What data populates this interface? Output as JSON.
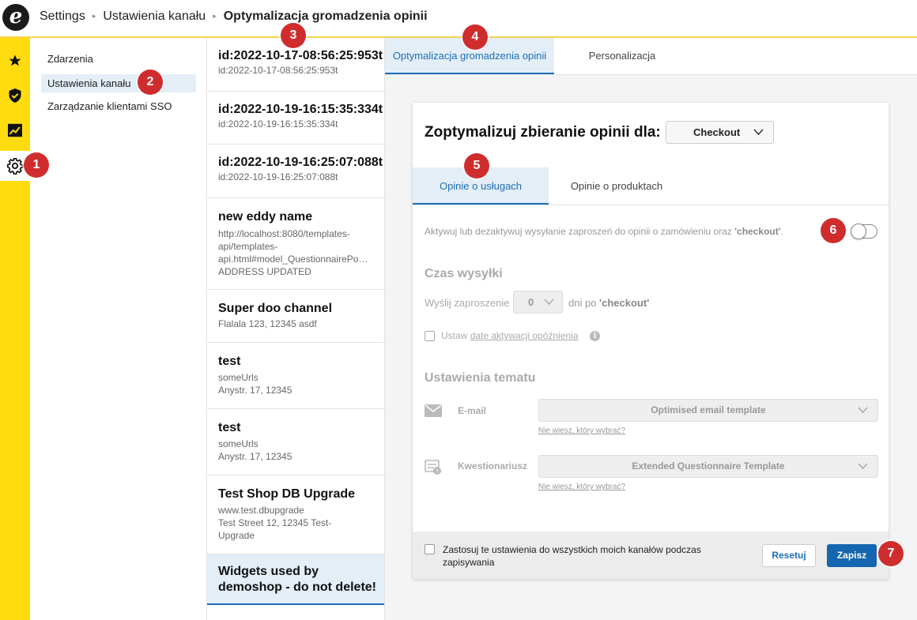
{
  "header": {
    "logo_letter": "e",
    "breadcrumbs": [
      "Settings",
      "Ustawienia kanału",
      "Optymalizacja gromadzenia opinii"
    ]
  },
  "rail": {
    "items": [
      {
        "icon": "star-icon"
      },
      {
        "icon": "shield-check-icon"
      },
      {
        "icon": "chart-icon"
      },
      {
        "icon": "gear-icon",
        "active": true
      }
    ]
  },
  "nav": {
    "items": [
      "Zdarzenia",
      "Ustawienia kanału",
      "Zarządzanie klientami SSO"
    ],
    "active_index": 1
  },
  "channels": [
    {
      "title": "id:2022-10-17-08:56:25:953t",
      "lines": [
        "id:2022-10-17-08:56:25:953t"
      ]
    },
    {
      "title": "id:2022-10-19-16:15:35:334t",
      "lines": [
        "id:2022-10-19-16:15:35:334t"
      ]
    },
    {
      "title": "id:2022-10-19-16:25:07:088t",
      "lines": [
        "id:2022-10-19-16:25:07:088t"
      ]
    },
    {
      "title": "new eddy name",
      "lines": [
        "http://localhost:8080/templates-",
        "api/templates-",
        "api.html#model_QuestionnairePo…",
        "ADDRESS UPDATED"
      ]
    },
    {
      "title": "Super doo channel",
      "lines": [
        "Flalala 123, 12345 asdf"
      ]
    },
    {
      "title": "test",
      "lines": [
        "someUrls",
        "Anystr. 17, 12345"
      ]
    },
    {
      "title": "test",
      "lines": [
        "someUrls",
        "Anystr. 17, 12345"
      ]
    },
    {
      "title": "Test Shop DB Upgrade",
      "lines": [
        "www.test.dbupgrade",
        "Test Street 12, 12345 Test-",
        "Upgrade"
      ]
    },
    {
      "title_lines": [
        "Widgets used by",
        "demoshop - do not delete!"
      ],
      "active": true
    }
  ],
  "main_tabs": [
    "Optymalizacja gromadzenia opinii",
    "Personalizacja"
  ],
  "card": {
    "title": "Zoptymalizuj zbieranie opinii dla:",
    "channel_select": "Checkout",
    "sub_tabs": [
      "Opinie o usługach",
      "Opinie o produktach"
    ],
    "activate_text": "Aktywuj lub dezaktywuj wysyłanie zaproszeń do opinii o zamówieniu oraz ",
    "activate_bold": "'checkout'",
    "activate_end": ".",
    "toggle_on": false,
    "send_time_heading": "Czas wysyłki",
    "send_invite_label": "Wyślij zaproszenie",
    "send_days_value": "0",
    "send_after": "dni po ",
    "send_after_bold": "'checkout'",
    "delay_prefix": "Ustaw ",
    "delay_link": "datę aktywacji opóźnienia",
    "theme_heading": "Ustawienia tematu",
    "email_label": "E-mail",
    "email_template": "Optimised email template",
    "email_help": "Nie wiesz, który wybrać?",
    "questionnaire_label": "Kwestionariusz",
    "questionnaire_template": "Extended Questionnaire Template",
    "questionnaire_help": "Nie wiesz, który wybrać?",
    "apply_all": "Zastosuj te ustawienia do wszystkich moich kanałów podczas zapisywania",
    "reset": "Resetuj",
    "save": "Zapisz"
  },
  "badges": [
    "1",
    "2",
    "3",
    "4",
    "5",
    "6",
    "7"
  ],
  "colors": {
    "accent": "#1d6fb8",
    "rail": "#ffdc0f",
    "badge": "#cf2d2d"
  }
}
